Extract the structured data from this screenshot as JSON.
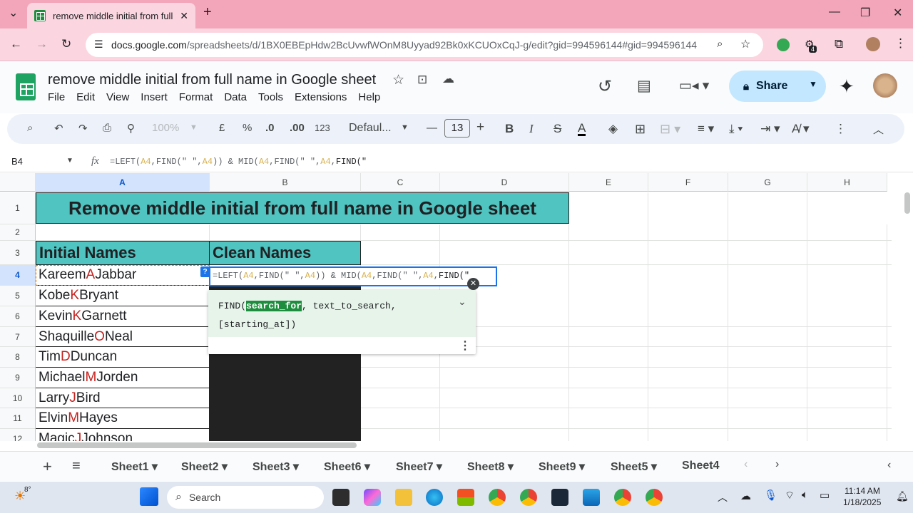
{
  "browser": {
    "tab_title": "remove middle initial from full",
    "url_host": "docs.google.com",
    "url_path": "/spreadsheets/d/1BX0EBEpHdw2BcUvwfWOnM8Uyyad92Bk0xKCUOxCqJ-g/edit?gid=994596144#gid=994596144",
    "extension_badge": "4"
  },
  "doc": {
    "title": "remove middle initial from full name in Google sheet",
    "menus": [
      "File",
      "Edit",
      "View",
      "Insert",
      "Format",
      "Data",
      "Tools",
      "Extensions",
      "Help"
    ],
    "share_label": "Share"
  },
  "toolbar": {
    "zoom": "100%",
    "currency": "£",
    "percent": "%",
    "dec_dec": ".0",
    "dec_inc": ".00",
    "num_format": "123",
    "font": "Defaul...",
    "font_size": "13"
  },
  "formula_bar": {
    "name_box": "B4",
    "fx": "fx"
  },
  "columns": [
    "A",
    "B",
    "C",
    "D",
    "E",
    "F",
    "G",
    "H"
  ],
  "rows": [
    "1",
    "2",
    "3",
    "4",
    "5",
    "6",
    "7",
    "8",
    "9",
    "10",
    "11",
    "12"
  ],
  "sheet": {
    "title": "Remove middle initial from full name in Google sheet",
    "header_a": "Initial Names",
    "header_b": "Clean Names",
    "names": [
      {
        "first": "Kareem",
        "mid": "A",
        "last": "Jabbar"
      },
      {
        "first": "Kobe",
        "mid": "K",
        "last": "Bryant"
      },
      {
        "first": "Kevin",
        "mid": "K",
        "last": "Garnett"
      },
      {
        "first": "Shaquille",
        "mid": "O",
        "last": "Neal"
      },
      {
        "first": "Tim",
        "mid": "D",
        "last": "Duncan"
      },
      {
        "first": "Michael",
        "mid": "M",
        "last": "Jorden"
      },
      {
        "first": "Larry",
        "mid": "J",
        "last": "Bird"
      },
      {
        "first": "Elvin",
        "mid": "M",
        "last": "Hayes"
      },
      {
        "first": "Magic",
        "mid": "J",
        "last": "Johnson"
      }
    ]
  },
  "editor": {
    "help_badge": "?",
    "fn_name": "FIND(",
    "param_active": "search_for",
    "param_rest": ", text_to_search,",
    "param_opt": "[starting_at])"
  },
  "sheet_tabs": [
    "Sheet1",
    "Sheet2",
    "Sheet3",
    "Sheet6",
    "Sheet7",
    "Sheet8",
    "Sheet9",
    "Sheet5",
    "Sheet4"
  ],
  "taskbar": {
    "weather": "8°",
    "search_placeholder": "Search",
    "time": "11:14 AM",
    "date": "1/18/2025"
  },
  "colors": {
    "header_teal": "#4fc4c0",
    "initial_red": "#c5221f",
    "chrome_pink": "#f3a6ba",
    "share_blue": "#c2e7ff"
  }
}
